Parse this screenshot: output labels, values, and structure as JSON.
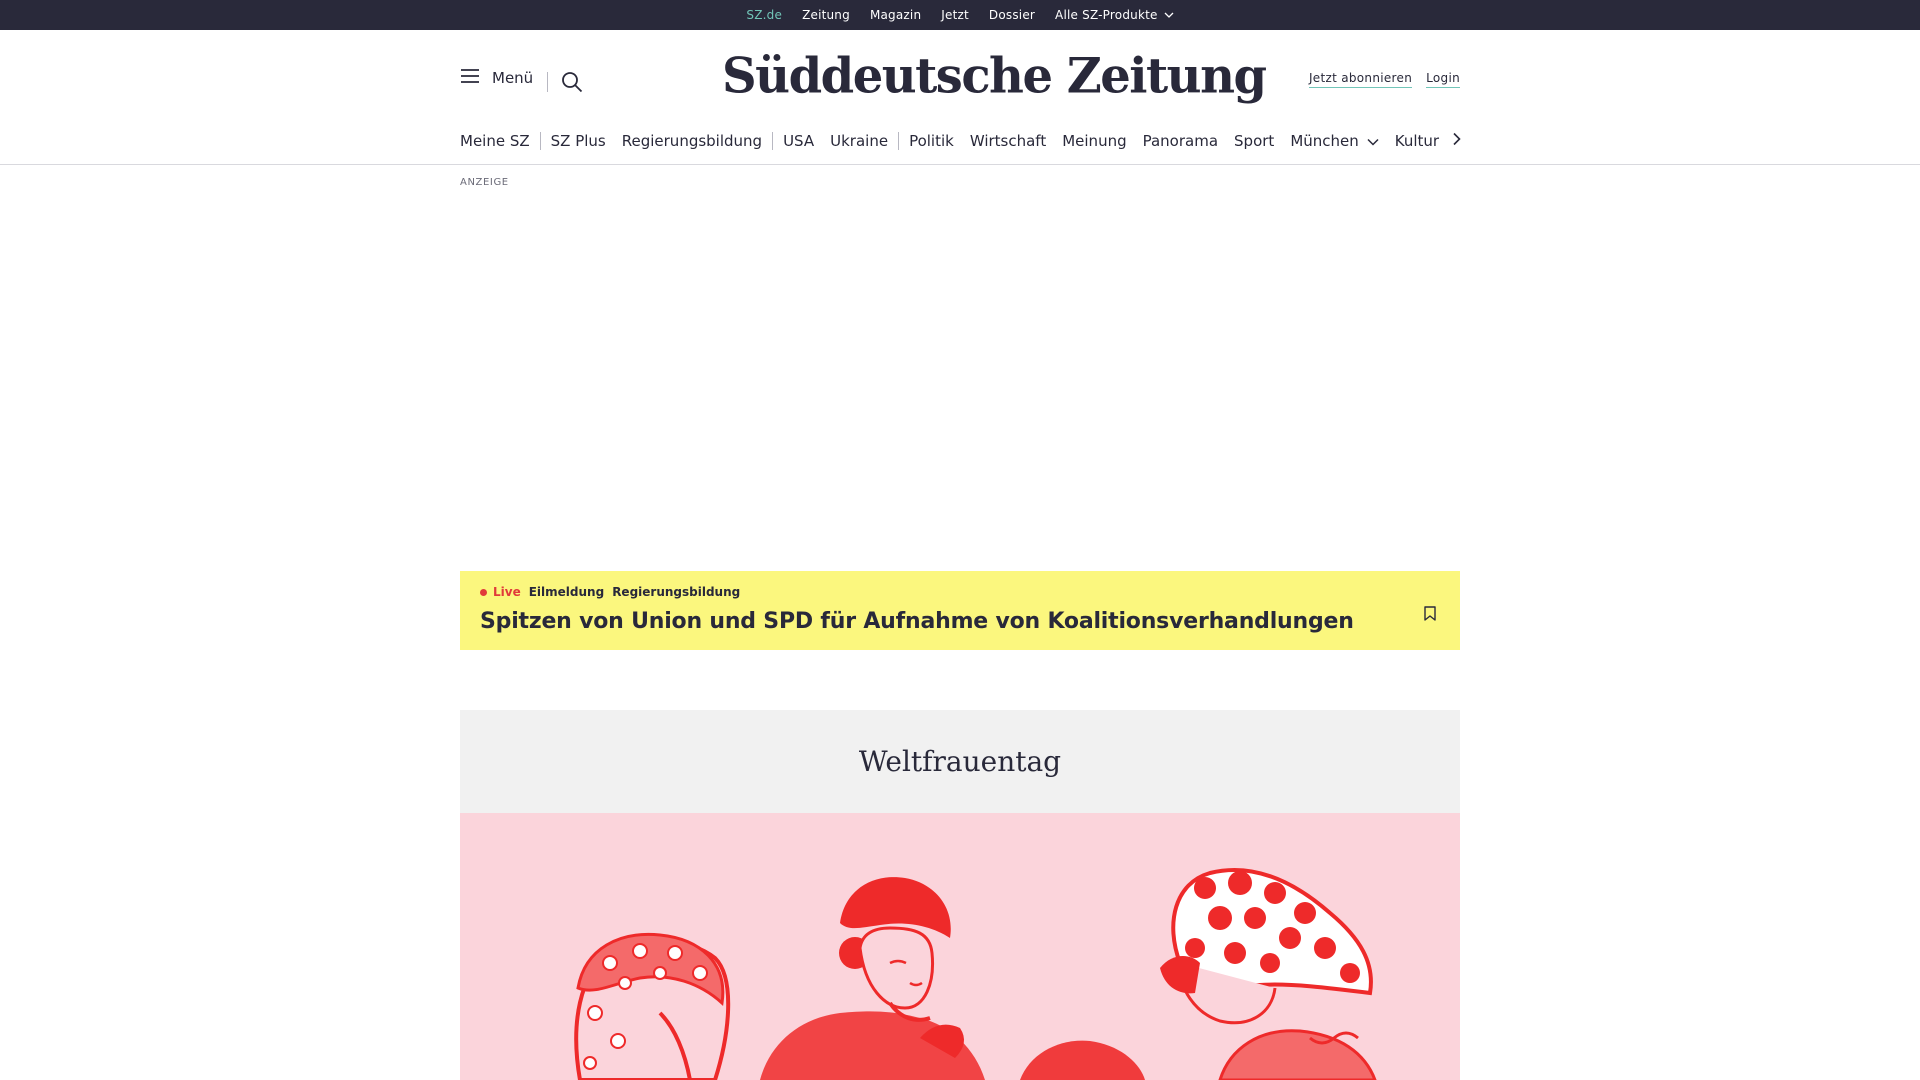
{
  "topbar": {
    "links": [
      "SZ.de",
      "Zeitung",
      "Magazin",
      "Jetzt",
      "Dossier",
      "Alle SZ-Produkte"
    ]
  },
  "header": {
    "menu_label": "Menü",
    "logo_text": "Süddeutsche Zeitung",
    "subscribe_label": "Jetzt abonnieren",
    "login_label": "Login"
  },
  "ressorts": [
    "Meine SZ",
    "SZ Plus",
    "Regierungsbildung",
    "USA",
    "Ukraine",
    "Politik",
    "Wirtschaft",
    "Meinung",
    "Panorama",
    "Sport",
    "München",
    "Kultur"
  ],
  "ad": {
    "label": "ANZEIGE"
  },
  "breaking": {
    "live_label": "Live",
    "tag1": "Eilmeldung",
    "tag2": "Regierungsbildung",
    "title": "Spitzen von Union und SPD für Aufnahme von Koalitionsverhandlungen"
  },
  "feature": {
    "title": "Weltfrauentag"
  },
  "colors": {
    "topbar_bg": "#29293a",
    "accent": "#71c5b8",
    "breaking_bg": "#fbf77e",
    "live_red": "#e03a3a",
    "feature_pink": "#fbd4db",
    "illustration_red": "#ee2a2a"
  },
  "icons": [
    "menu-icon",
    "search-icon",
    "chevron-down-icon",
    "chevron-right-icon",
    "bookmark-icon"
  ]
}
